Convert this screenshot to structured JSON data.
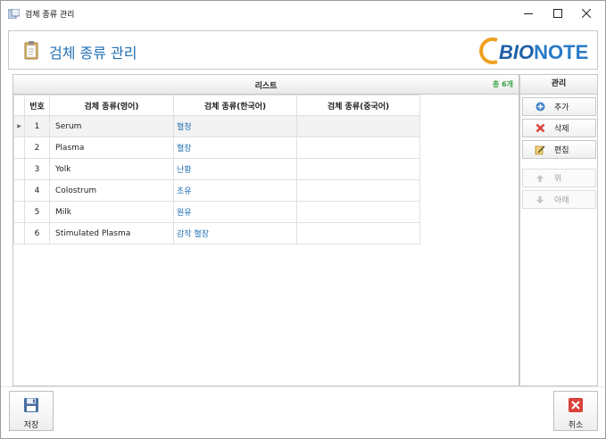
{
  "window": {
    "title": "검체 종류 관리",
    "controls": [
      "minimize-icon",
      "maximize-icon",
      "close-icon"
    ]
  },
  "header": {
    "title": "검체 종류 관리",
    "logo_text_a": "BIO",
    "logo_text_b": "NOTE"
  },
  "list": {
    "panel_title": "리스트",
    "count_label": "총 6개",
    "columns": [
      "번호",
      "검체 종류(영어)",
      "검체 종류(한국어)",
      "검체 종류(중국어)"
    ],
    "rows": [
      {
        "no": "1",
        "en": "Serum",
        "ko": "혈청",
        "zh": "",
        "selected": true
      },
      {
        "no": "2",
        "en": "Plasma",
        "ko": "혈장",
        "zh": ""
      },
      {
        "no": "3",
        "en": "Yolk",
        "ko": "난황",
        "zh": ""
      },
      {
        "no": "4",
        "en": "Colostrum",
        "ko": "초유",
        "zh": ""
      },
      {
        "no": "5",
        "en": "Milk",
        "ko": "원유",
        "zh": ""
      },
      {
        "no": "6",
        "en": "Stimulated Plasma",
        "ko": "감작 혈장",
        "zh": ""
      }
    ]
  },
  "manage": {
    "title": "관리",
    "add": "추가",
    "delete": "삭제",
    "edit": "편집",
    "up": "위",
    "down": "아래"
  },
  "footer": {
    "save": "저장",
    "cancel": "취소"
  },
  "colors": {
    "accent_blue": "#1f6fb3",
    "count_green": "#3aa34a",
    "cancel_red": "#d9423a"
  }
}
